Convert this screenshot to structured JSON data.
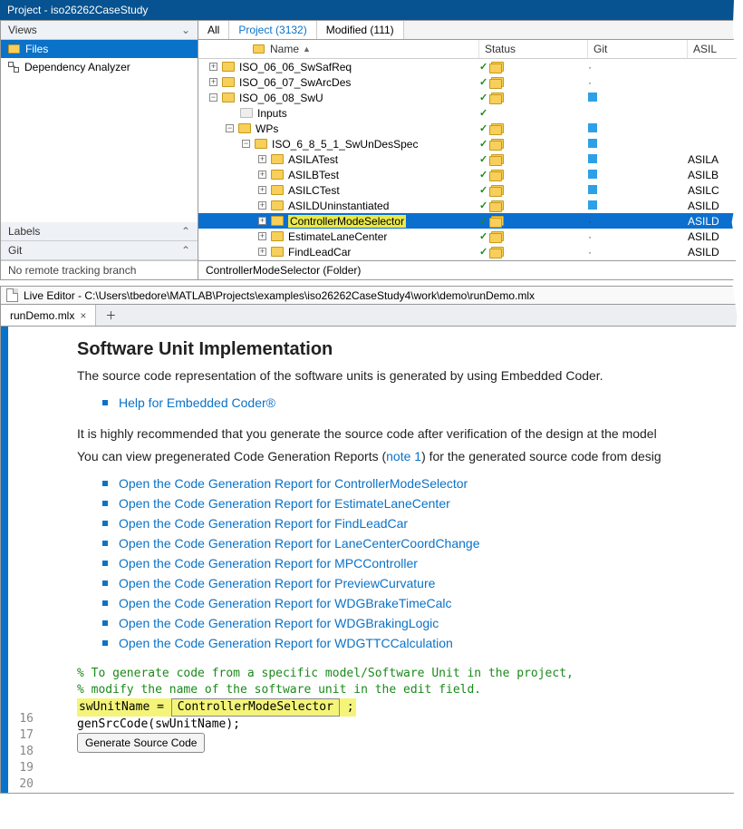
{
  "titlebar": "Project - iso26262CaseStudy",
  "left": {
    "views_label": "Views",
    "files_label": "Files",
    "dep_label": "Dependency Analyzer",
    "labels_label": "Labels",
    "git_label": "Git",
    "no_remote": "No remote tracking branch"
  },
  "tabs": {
    "all": "All",
    "project": "Project (3132)",
    "modified": "Modified (111)"
  },
  "cols": {
    "name": "Name",
    "status": "Status",
    "git": "Git",
    "asil": "ASIL"
  },
  "tree": [
    {
      "indent": 0,
      "box": "+",
      "name": "ISO_06_06_SwSafReq",
      "status": "cf",
      "git": "dot",
      "asil": ""
    },
    {
      "indent": 0,
      "box": "+",
      "name": "ISO_06_07_SwArcDes",
      "status": "cf",
      "git": "dot",
      "asil": ""
    },
    {
      "indent": 0,
      "box": "-",
      "name": "ISO_06_08_SwU",
      "status": "cf",
      "git": "sq",
      "asil": ""
    },
    {
      "indent": 1,
      "box": "",
      "dim": true,
      "name": "Inputs",
      "status": "c",
      "git": "",
      "asil": ""
    },
    {
      "indent": 1,
      "box": "-",
      "name": "WPs",
      "status": "cf",
      "git": "sq",
      "asil": ""
    },
    {
      "indent": 2,
      "box": "-",
      "name": "ISO_6_8_5_1_SwUnDesSpec",
      "status": "cf",
      "git": "sq",
      "asil": ""
    },
    {
      "indent": 3,
      "box": "+",
      "name": "ASILATest",
      "status": "cf",
      "git": "sq",
      "asil": "ASILA"
    },
    {
      "indent": 3,
      "box": "+",
      "name": "ASILBTest",
      "status": "cf",
      "git": "sq",
      "asil": "ASILB"
    },
    {
      "indent": 3,
      "box": "+",
      "name": "ASILCTest",
      "status": "cf",
      "git": "sq",
      "asil": "ASILC"
    },
    {
      "indent": 3,
      "box": "+",
      "name": "ASILDUninstantiated",
      "status": "cf",
      "git": "sq",
      "asil": "ASILD"
    },
    {
      "indent": 3,
      "box": "+",
      "name": "ControllerModeSelector",
      "status": "cf",
      "git": "dot",
      "asil": "ASILD",
      "sel": true,
      "hl": true
    },
    {
      "indent": 3,
      "box": "+",
      "name": "EstimateLaneCenter",
      "status": "cf",
      "git": "dot",
      "asil": "ASILD"
    },
    {
      "indent": 3,
      "box": "+",
      "name": "FindLeadCar",
      "status": "cf",
      "git": "dot",
      "asil": "ASILD"
    }
  ],
  "status_footer": "ControllerModeSelector (Folder)",
  "editor": {
    "title": "Live Editor - C:\\Users\\tbedore\\MATLAB\\Projects\\examples\\iso26262CaseStudy4\\work\\demo\\runDemo.mlx",
    "tab": "runDemo.mlx",
    "heading": "Software Unit Implementation",
    "p1": "The source code representation of the software units is generated by using Embedded Coder.",
    "help_link": "Help for Embedded Coder®",
    "p2": "It is highly recommended that you generate the source code after verification of the design at the model",
    "p3a": "You can view pregenerated Code Generation Reports (",
    "p3_note": "note 1",
    "p3b": ") for the generated source code from desig",
    "links": [
      "Open the Code Generation Report for ControllerModeSelector",
      "Open the Code Generation Report for EstimateLaneCenter",
      "Open the Code Generation Report for FindLeadCar",
      "Open the Code Generation Report for LaneCenterCoordChange",
      "Open the Code Generation Report for MPCController",
      "Open the Code Generation Report for PreviewCurvature",
      "Open the Code Generation Report for WDGBrakeTimeCalc",
      "Open the Code Generation Report for WDGBrakingLogic",
      "Open the Code Generation Report for WDGTTCCalculation"
    ],
    "code": {
      "l16": "% To generate code from a specific model/Software Unit in the project,",
      "l17": "% modify the name of the software unit in the edit field.",
      "l18a": "swUnitName = ",
      "l18_field": "ControllerModeSelector",
      "l18b": ";",
      "l19": "genSrcCode(swUnitName);",
      "l20_btn": "Generate Source Code"
    },
    "linenos": [
      "16",
      "17",
      "18",
      "19",
      "20"
    ]
  }
}
